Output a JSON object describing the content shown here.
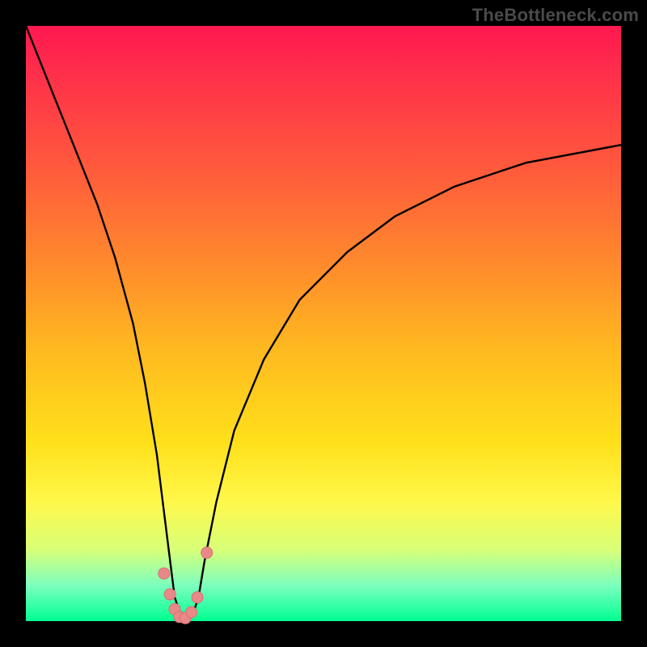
{
  "watermark": "TheBottleneck.com",
  "colors": {
    "frame": "#000000",
    "curve_stroke": "#000000",
    "marker_fill": "#e98888",
    "marker_stroke": "#d87070"
  },
  "chart_data": {
    "type": "line",
    "title": "",
    "xlabel": "",
    "ylabel": "",
    "xlim": [
      0,
      100
    ],
    "ylim": [
      0,
      100
    ],
    "grid": false,
    "series": [
      {
        "name": "bottleneck-curve",
        "x": [
          0,
          4,
          8,
          12,
          15,
          18,
          20,
          22,
          24,
          25,
          26,
          27,
          28,
          29,
          30,
          32,
          35,
          40,
          46,
          54,
          62,
          72,
          84,
          100
        ],
        "y": [
          100,
          90,
          80,
          70,
          61,
          50,
          40,
          28,
          12,
          4,
          1,
          0,
          1,
          4,
          10,
          20,
          32,
          44,
          54,
          62,
          68,
          73,
          77,
          80
        ]
      }
    ],
    "markers": {
      "name": "trough-markers",
      "x": [
        23.2,
        24.2,
        25.0,
        25.8,
        26.8,
        27.8,
        28.8,
        30.4
      ],
      "y": [
        8.0,
        4.5,
        2.0,
        0.7,
        0.5,
        1.5,
        4.0,
        11.5
      ]
    }
  }
}
